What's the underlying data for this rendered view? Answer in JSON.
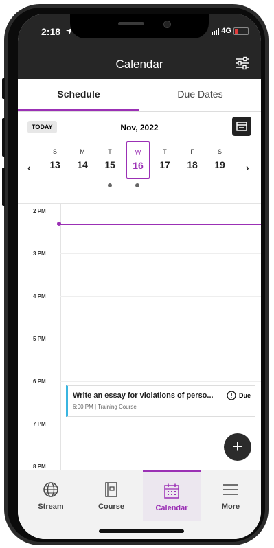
{
  "status_bar": {
    "time": "2:18",
    "network": "4G"
  },
  "header": {
    "title": "Calendar"
  },
  "tabs": [
    {
      "label": "Schedule"
    },
    {
      "label": "Due Dates"
    }
  ],
  "date_bar": {
    "today_label": "TODAY",
    "month_label": "Nov, 2022"
  },
  "week": {
    "prev": "‹",
    "next": "›",
    "days": [
      {
        "letter": "S",
        "num": "13"
      },
      {
        "letter": "M",
        "num": "14"
      },
      {
        "letter": "T",
        "num": "15"
      },
      {
        "letter": "W",
        "num": "16"
      },
      {
        "letter": "T",
        "num": "17"
      },
      {
        "letter": "F",
        "num": "18"
      },
      {
        "letter": "S",
        "num": "19"
      }
    ]
  },
  "hours": [
    "2 PM",
    "3 PM",
    "4 PM",
    "5 PM",
    "6 PM",
    "7 PM",
    "8 PM"
  ],
  "event": {
    "title": "Write an essay for violations of perso...",
    "subtitle": "6:00 PM | Training Course",
    "badge": "Due"
  },
  "fab_label": "+",
  "nav": [
    {
      "label": "Stream",
      "icon": "globe-icon"
    },
    {
      "label": "Course",
      "icon": "book-icon"
    },
    {
      "label": "Calendar",
      "icon": "calendar-icon"
    },
    {
      "label": "More",
      "icon": "menu-icon"
    }
  ],
  "colors": {
    "accent": "#9b30b5",
    "topbar": "#262626",
    "event_stripe": "#39b5e0"
  }
}
